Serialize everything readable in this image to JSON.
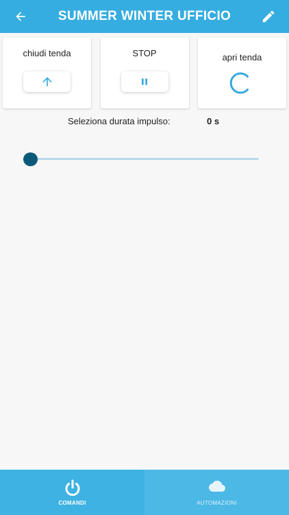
{
  "header": {
    "title": "SUMMER WINTER UFFICIO",
    "back_icon": "arrow-left-icon",
    "edit_icon": "pencil-icon",
    "background": "#36ade0"
  },
  "commands": [
    {
      "label": "chiudi tenda",
      "icon": "arrow-up-icon",
      "state": "idle"
    },
    {
      "label": "STOP",
      "icon": "pause-icon",
      "state": "idle"
    },
    {
      "label": "apri tenda",
      "icon": "loading-spinner-icon",
      "state": "loading"
    }
  ],
  "impulse": {
    "label": "Seleziona durata impulso:",
    "value": "0 s",
    "slider_level": 0
  },
  "bottom_nav": {
    "items": [
      {
        "label": "COMANDI",
        "icon": "power-icon",
        "active": true
      },
      {
        "label": "AUTOMAZIONI",
        "icon": "cloud-icon",
        "active": false
      }
    ]
  },
  "colors": {
    "accent": "#36ade0",
    "icon_blue": "#35a8dc",
    "slider_thumb": "#0c5a7a",
    "slider_track": "#b9d9e6"
  }
}
